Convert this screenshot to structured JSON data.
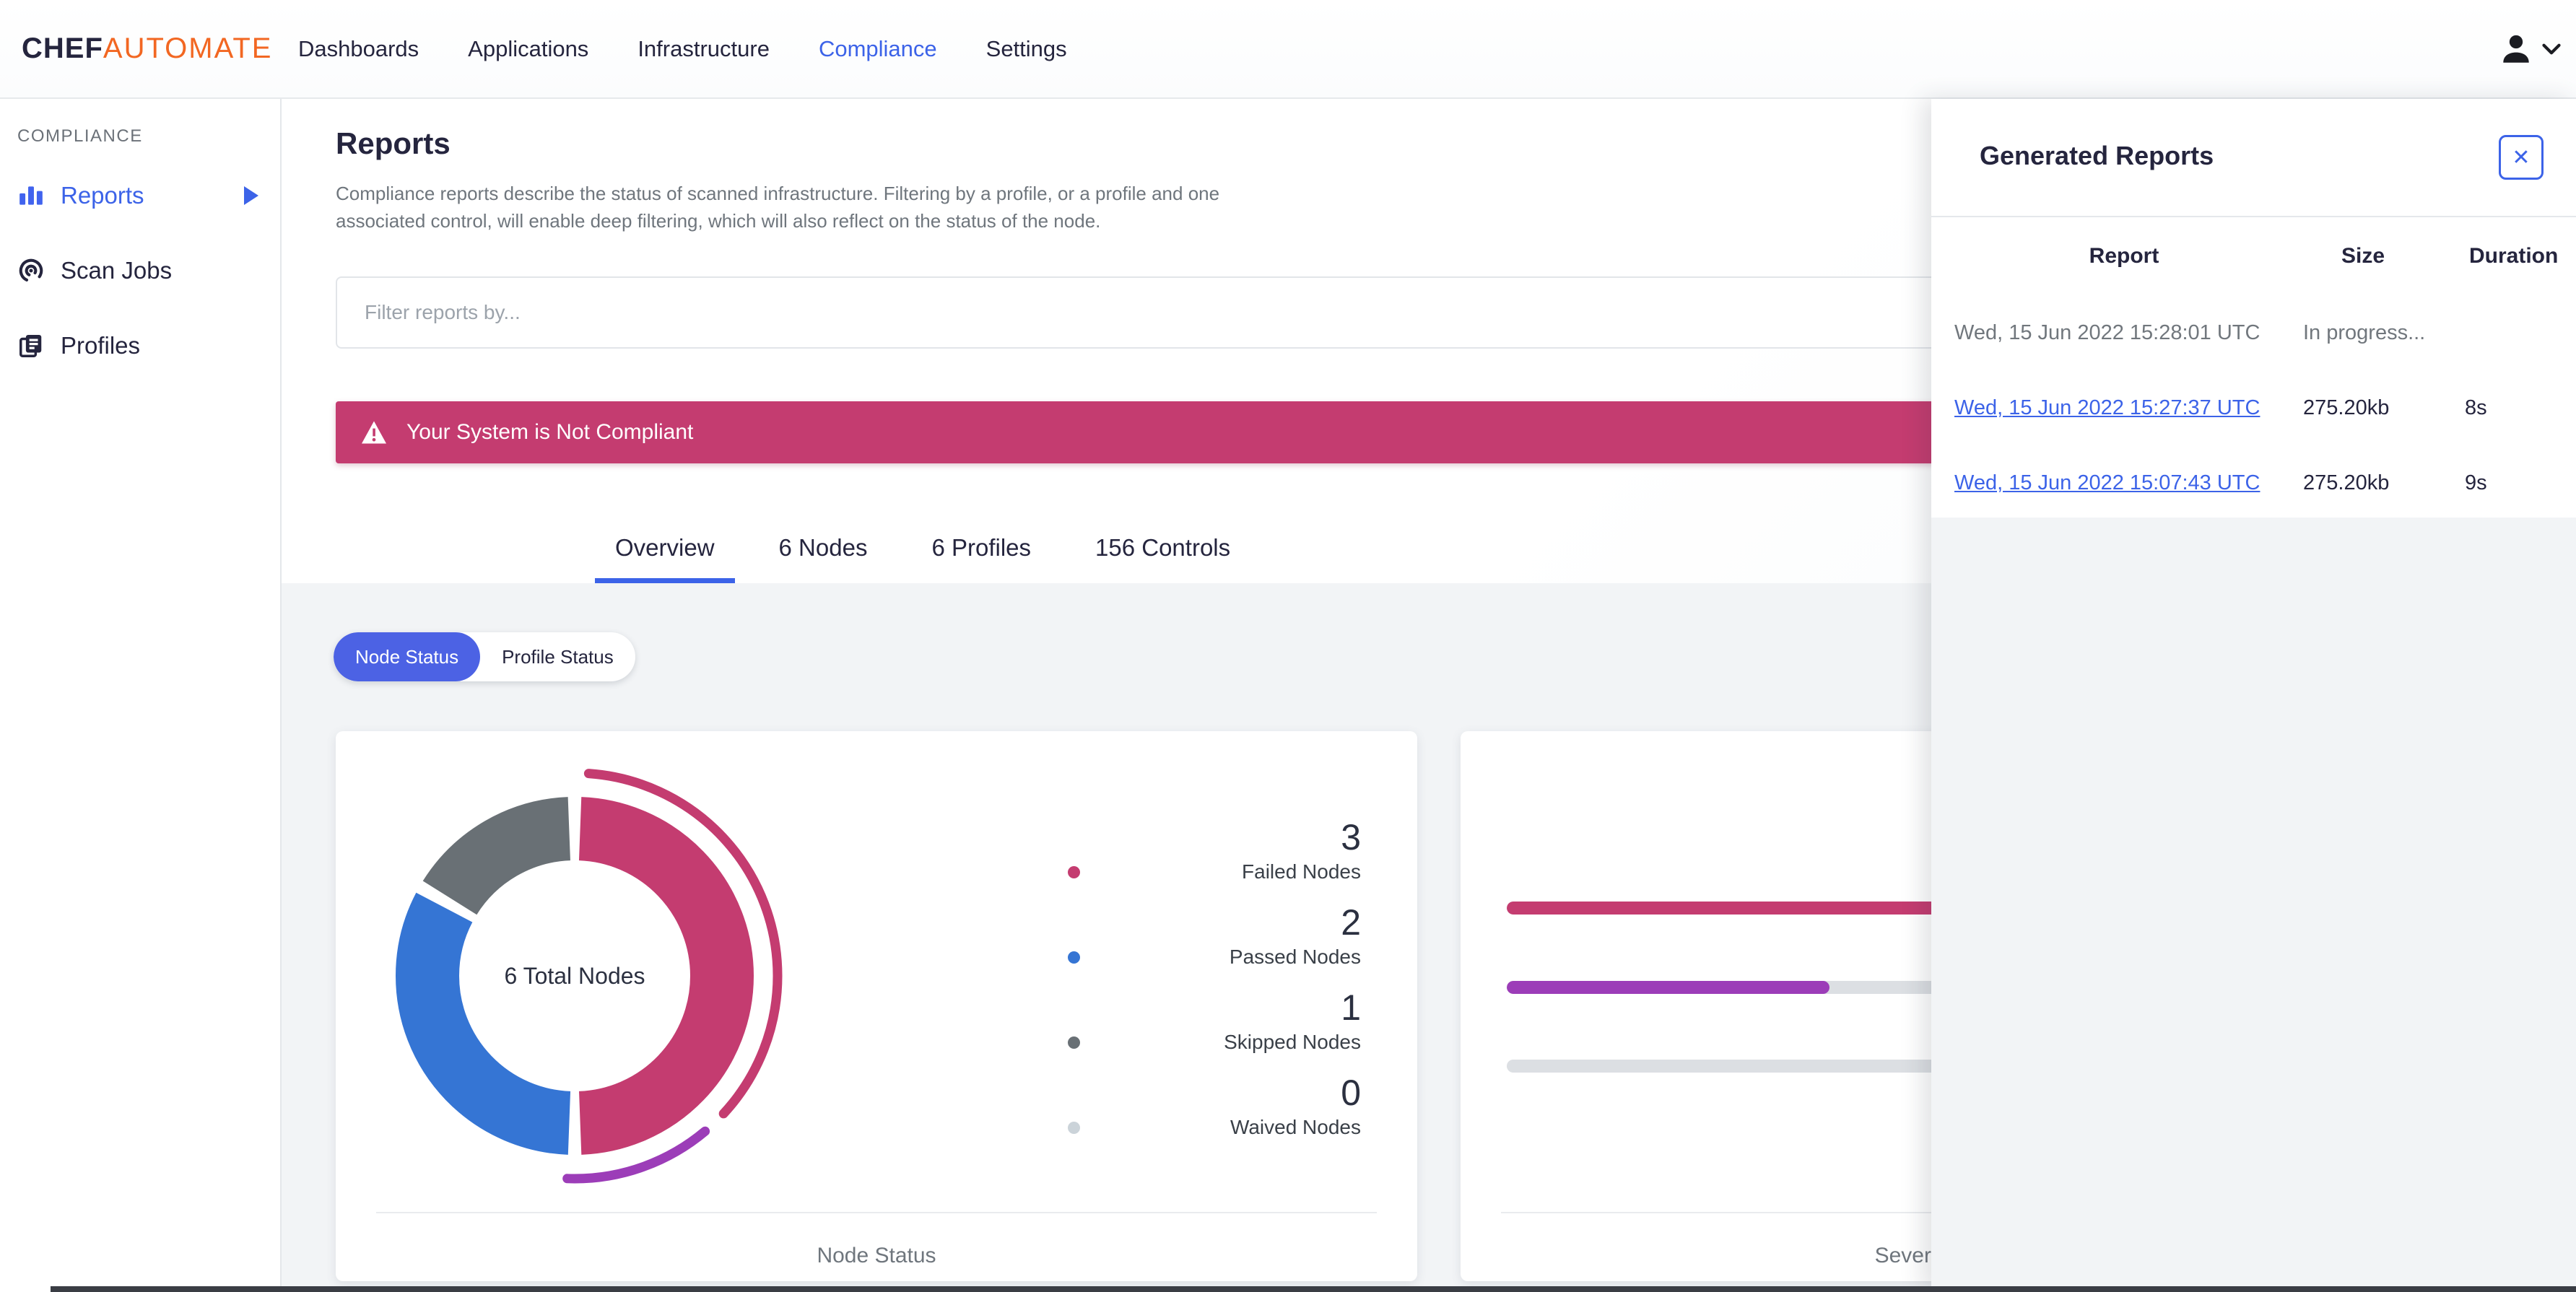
{
  "brand": {
    "name_bold": "CHEF",
    "name_light": "AUTOMATE"
  },
  "nav": {
    "items": [
      {
        "label": "Dashboards",
        "active": false
      },
      {
        "label": "Applications",
        "active": false
      },
      {
        "label": "Infrastructure",
        "active": false
      },
      {
        "label": "Compliance",
        "active": true
      },
      {
        "label": "Settings",
        "active": false
      }
    ],
    "user_icons": [
      "person-icon",
      "chevron-down-icon"
    ]
  },
  "sidebar": {
    "section_label": "COMPLIANCE",
    "items": [
      {
        "label": "Reports",
        "icon": "bar-chart-icon",
        "active": true,
        "has_submenu": true
      },
      {
        "label": "Scan Jobs",
        "icon": "scan-target-icon",
        "active": false,
        "has_submenu": false
      },
      {
        "label": "Profiles",
        "icon": "documents-icon",
        "active": false,
        "has_submenu": false
      }
    ]
  },
  "page": {
    "title": "Reports",
    "description": "Compliance reports describe the status of scanned infrastructure. Filtering by a profile, or a profile and one associated control, will enable deep filtering, which will also reflect on the status of the node.",
    "filter_placeholder": "Filter reports by...",
    "banner_text": "Your System is Not Compliant",
    "banner_color": "#C43C70"
  },
  "tabs": [
    {
      "label": "Overview",
      "active": true
    },
    {
      "label": "6 Nodes",
      "active": false
    },
    {
      "label": "6 Profiles",
      "active": false
    },
    {
      "label": "156 Controls",
      "active": false
    }
  ],
  "toggle": {
    "options": [
      {
        "label": "Node Status",
        "active": true
      },
      {
        "label": "Profile Status",
        "active": false
      }
    ]
  },
  "node_status_card": {
    "center_label": "6 Total Nodes",
    "footer": "Node Status",
    "legend": [
      {
        "value": "3",
        "label": "Failed Nodes",
        "color": "#C43C70"
      },
      {
        "value": "2",
        "label": "Passed Nodes",
        "color": "#3575D4"
      },
      {
        "value": "1",
        "label": "Skipped Nodes",
        "color": "#697075"
      },
      {
        "value": "0",
        "label": "Waived Nodes",
        "color": "#CBD3D9"
      }
    ]
  },
  "severity_card": {
    "footer": "Severity of Node Failures",
    "bars": [
      {
        "color": "#C43C70",
        "percent": 100
      },
      {
        "color": "#9C3DB8",
        "percent": 33
      },
      {
        "color": "#DCDFE3",
        "percent": 0
      }
    ]
  },
  "drawer": {
    "title": "Generated Reports",
    "close_icon": "✕",
    "columns": [
      "Report",
      "Size",
      "Duration"
    ],
    "rows": [
      {
        "report": "Wed, 15 Jun 2022 15:28:01 UTC",
        "size": "In progress...",
        "duration": "",
        "is_link": false
      },
      {
        "report": "Wed, 15 Jun 2022 15:27:37 UTC",
        "size": "275.20kb",
        "duration": "8s",
        "is_link": true
      },
      {
        "report": "Wed, 15 Jun 2022 15:07:43 UTC",
        "size": "275.20kb",
        "duration": "9s",
        "is_link": true
      }
    ]
  },
  "colors": {
    "accent_blue": "#3C63E8",
    "pill_blue": "#4C62E4",
    "brand_orange": "#F26722",
    "dark_text": "#25253E",
    "muted_text": "#6F767D",
    "bg_gray": "#F2F4F6"
  },
  "chart_data": [
    {
      "type": "pie",
      "donut": true,
      "title": "Node Status",
      "center_label": "6 Total Nodes",
      "labels": [
        "Failed Nodes",
        "Passed Nodes",
        "Skipped Nodes",
        "Waived Nodes"
      ],
      "values": [
        3,
        2,
        1,
        0
      ],
      "total": 6,
      "colors": [
        "#C43C70",
        "#3575D4",
        "#697075",
        "#CBD3D9"
      ],
      "legend_position": "right",
      "outer_highlight_arcs": [
        {
          "color": "#C43C70",
          "start_deg": 4,
          "end_deg": 133
        },
        {
          "color": "#9C3DB8",
          "start_deg": 140,
          "end_deg": 182
        }
      ]
    },
    {
      "type": "bar",
      "orientation": "horizontal",
      "title": "Severity of Node Failures",
      "note": "three unlabeled progress-style bars; fill percents estimated from pixels",
      "values_percent": [
        100,
        33,
        0
      ],
      "colors": [
        "#C43C70",
        "#9C3DB8",
        "#DCDFE3"
      ]
    }
  ]
}
